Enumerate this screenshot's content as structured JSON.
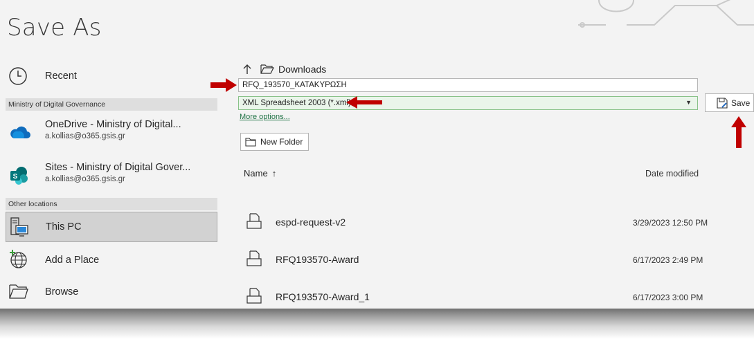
{
  "title": "Save As",
  "nav": {
    "recent": "Recent",
    "group_ministry": "Ministry of Digital Governance",
    "onedrive": {
      "name": "OneDrive - Ministry of Digital...",
      "account": "a.kollias@o365.gsis.gr"
    },
    "sites": {
      "name": "Sites - Ministry of Digital Gover...",
      "account": "a.kollias@o365.gsis.gr"
    },
    "group_other": "Other locations",
    "this_pc": "This PC",
    "add_place": "Add a Place",
    "browse": "Browse"
  },
  "location": {
    "folder": "Downloads"
  },
  "filename": "RFQ_193570_ΚΑΤΑΚΥΡΩΣΗ",
  "filetype": "XML Spreadsheet 2003 (*.xml)",
  "more_options": "More options...",
  "save_label": "Save",
  "new_folder_label": "New Folder",
  "columns": {
    "name": "Name",
    "date": "Date modified"
  },
  "files": [
    {
      "name": "espd-request-v2",
      "date": "3/29/2023 12:50 PM"
    },
    {
      "name": "RFQ193570-Award",
      "date": "6/17/2023 2:49 PM"
    },
    {
      "name": "RFQ193570-Award_1",
      "date": "6/17/2023 3:00 PM"
    }
  ],
  "colors": {
    "accent_green": "#217346",
    "annotation_red": "#c00000",
    "selected_bg": "#d2d2d2"
  },
  "icons": [
    "clock-icon",
    "onedrive-cloud-icon",
    "sharepoint-icon",
    "pc-icon",
    "globe-add-icon",
    "folder-icon",
    "up-arrow-icon",
    "save-icon",
    "document-icon"
  ]
}
